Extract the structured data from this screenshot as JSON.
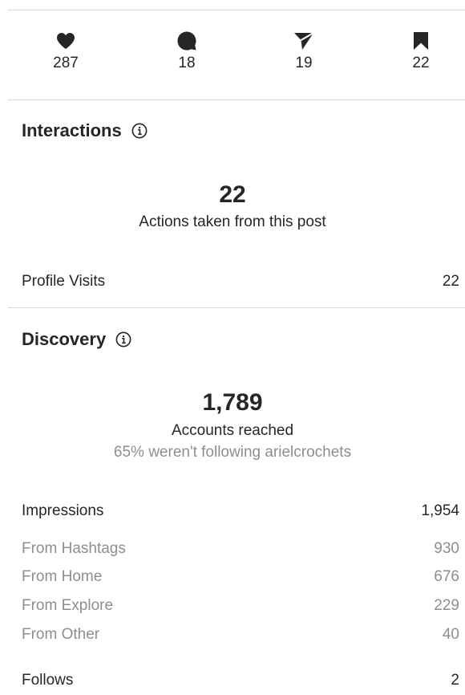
{
  "stats": {
    "likes": {
      "icon": "heart-icon",
      "value": "287"
    },
    "comments": {
      "icon": "comment-icon",
      "value": "18"
    },
    "shares": {
      "icon": "send-icon",
      "value": "19"
    },
    "saves": {
      "icon": "bookmark-icon",
      "value": "22"
    }
  },
  "interactions": {
    "title": "Interactions",
    "total": "22",
    "total_label": "Actions taken from this post",
    "rows": [
      {
        "label": "Profile Visits",
        "value": "22"
      }
    ]
  },
  "discovery": {
    "title": "Discovery",
    "reached": "1,789",
    "reached_label": "Accounts reached",
    "reached_note": "65% weren't following arielcrochets",
    "impressions": {
      "label": "Impressions",
      "value": "1,954"
    },
    "sources": [
      {
        "label": "From Hashtags",
        "value": "930"
      },
      {
        "label": "From Home",
        "value": "676"
      },
      {
        "label": "From Explore",
        "value": "229"
      },
      {
        "label": "From Other",
        "value": "40"
      }
    ],
    "follows": {
      "label": "Follows",
      "value": "2"
    }
  }
}
